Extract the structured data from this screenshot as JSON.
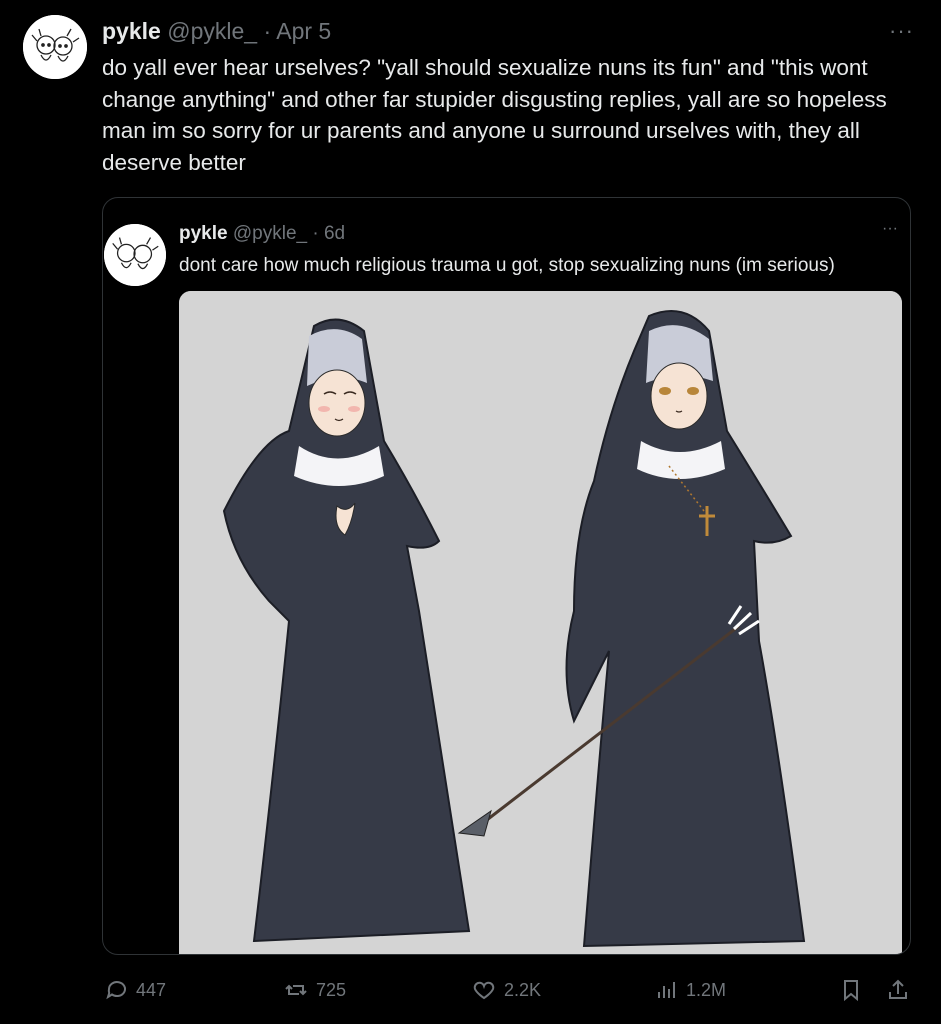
{
  "tweet": {
    "author_name": "pykle",
    "handle": "@pykle_",
    "separator": "·",
    "date": "Apr 5",
    "more_label": "···",
    "text": "do yall ever hear urselves? \"yall should sexualize nuns its fun\" and \"this wont change anything\" and other far stupider disgusting replies, yall are so hopeless man im so sorry for ur parents and anyone u surround urselves with, they all deserve better"
  },
  "quote": {
    "author_name": "pykle",
    "handle": "@pykle_",
    "separator": "·",
    "date": "6d",
    "more_label": "···",
    "text": "dont care how much religious trauma u got, stop sexualizing nuns (im serious)"
  },
  "actions": {
    "replies": "447",
    "reposts": "725",
    "likes": "2.2K",
    "views": "1.2M"
  },
  "colors": {
    "background": "#000000",
    "text": "#e7e9ea",
    "muted": "#71767b",
    "border": "#2f3336",
    "image_bg": "#d4d4d4",
    "habit": "#363a47"
  }
}
